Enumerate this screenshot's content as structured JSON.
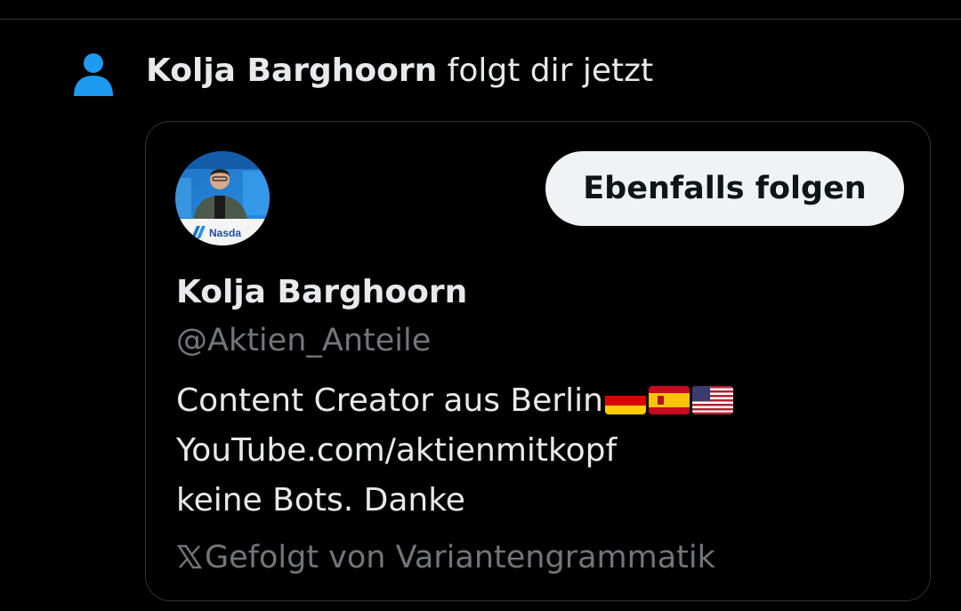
{
  "notification": {
    "icon": "person-icon",
    "actor_name": "Kolja Barghoorn",
    "action_text": " folgt dir jetzt"
  },
  "profile_card": {
    "avatar_caption": "Nasda",
    "follow_back_label": "Ebenfalls folgen",
    "display_name": "Kolja Barghoorn",
    "handle": "@Aktien_Anteile",
    "bio": {
      "line1": "Content Creator aus Berlin",
      "flags": [
        "germany-flag-icon",
        "spain-flag-icon",
        "usa-flag-icon"
      ],
      "line2": "YouTube.com/aktienmitkopf",
      "line3": "keine Bots. Danke"
    },
    "followed_by": "Gefolgt von Variantengrammatik"
  },
  "colors": {
    "background": "#000000",
    "text_primary": "#e7e9ea",
    "text_secondary": "#71767b",
    "accent_blue": "#1d9bf0",
    "button_bg": "#eff3f4",
    "button_text": "#0f1419",
    "border": "#2f3336"
  }
}
